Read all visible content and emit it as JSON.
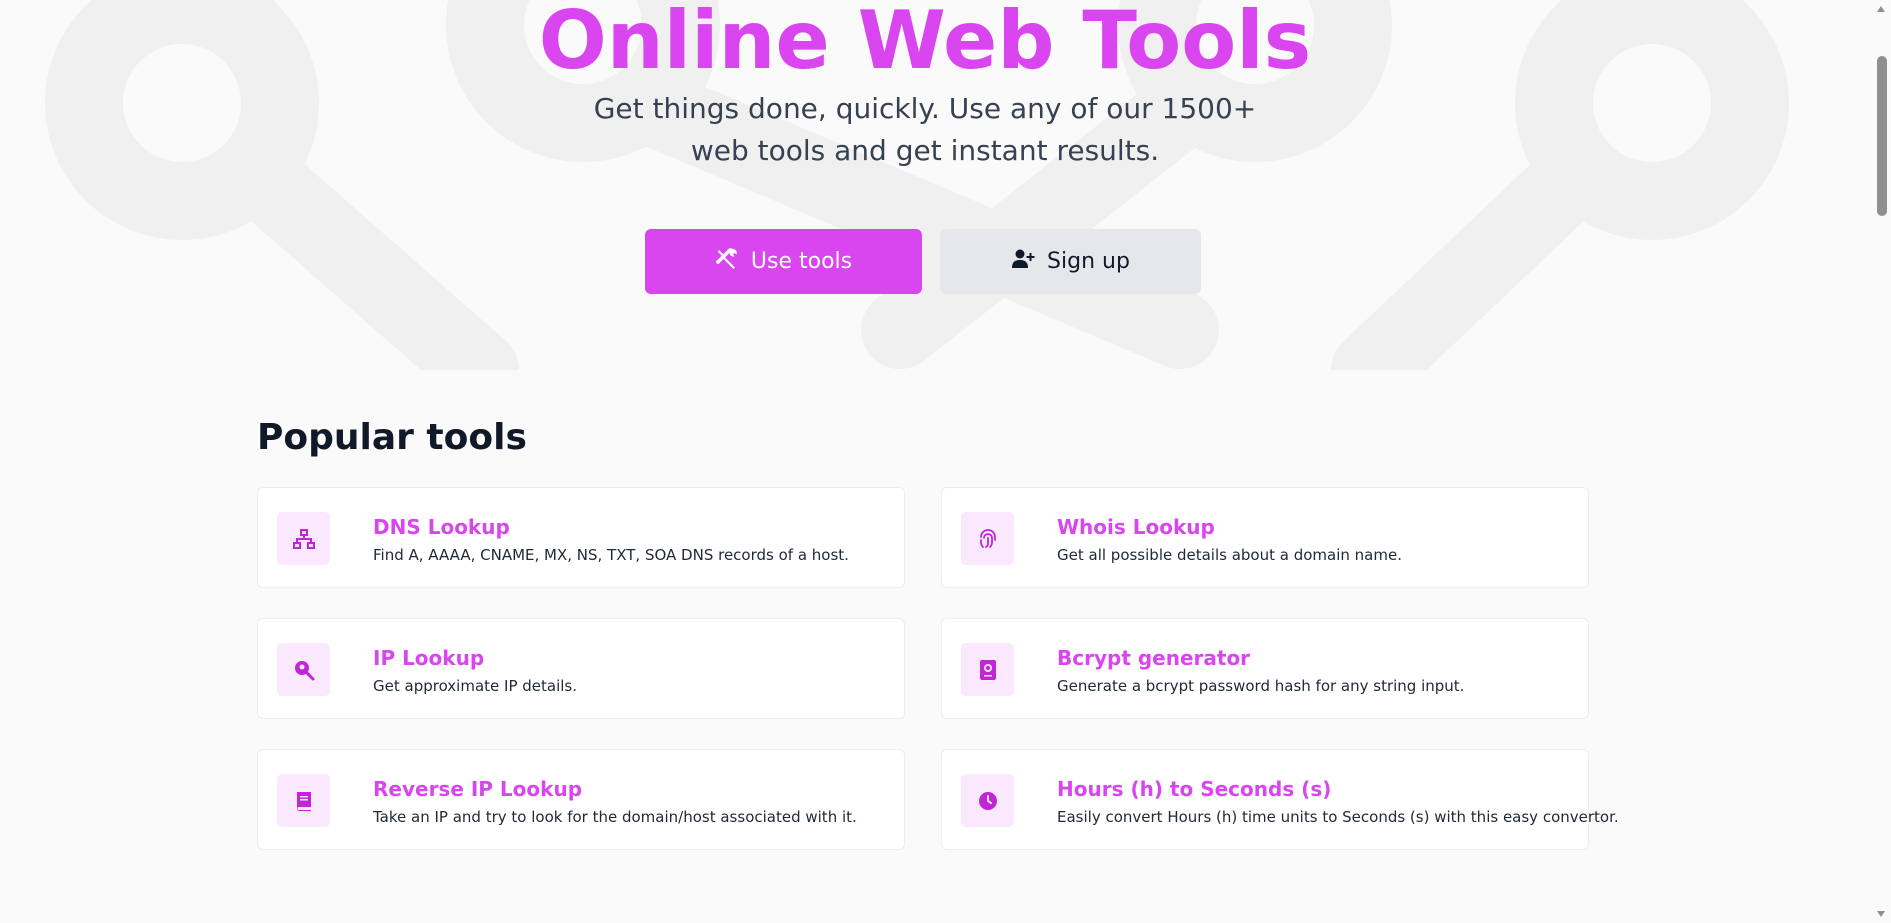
{
  "hero": {
    "title": "Online Web Tools",
    "subtitle": "Get things done, quickly. Use any of our 1500+ web tools and get instant results.",
    "primary_button": "Use tools",
    "secondary_button": "Sign up"
  },
  "popular": {
    "heading": "Popular tools",
    "tools": [
      {
        "title": "DNS Lookup",
        "description": "Find A, AAAA, CNAME, MX, NS, TXT, SOA DNS records of a host.",
        "icon": "network-icon"
      },
      {
        "title": "Whois Lookup",
        "description": "Get all possible details about a domain name.",
        "icon": "fingerprint-icon"
      },
      {
        "title": "IP Lookup",
        "description": "Get approximate IP details.",
        "icon": "search-location-icon"
      },
      {
        "title": "Bcrypt generator",
        "description": "Generate a bcrypt password hash for any string input.",
        "icon": "passport-icon"
      },
      {
        "title": "Reverse IP Lookup",
        "description": "Take an IP and try to look for the domain/host associated with it.",
        "icon": "book-icon"
      },
      {
        "title": "Hours (h) to Seconds (s)",
        "description": "Easily convert Hours (h) time units to Seconds (s) with this easy convertor.",
        "icon": "clock-icon"
      }
    ]
  },
  "colors": {
    "accent": "#d946ef",
    "accent_light": "#fae8ff",
    "secondary_button": "#e5e7eb"
  }
}
